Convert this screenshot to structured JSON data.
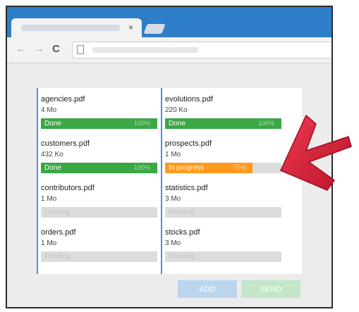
{
  "browser": {
    "tab_close": "×",
    "nav": {
      "back": "←",
      "forward": "→",
      "reload": "C"
    }
  },
  "colors": {
    "accent": "#4a90e2",
    "done": "#3aa845",
    "in_progress": "#ff9a1f",
    "pending": "#dcdcdc",
    "arrow": "#d7263d"
  },
  "files": [
    {
      "name": "agencies.pdf",
      "size": "4 Mo",
      "status": "Done",
      "progress": "100%",
      "state": "done",
      "fraction": 1.0
    },
    {
      "name": "customers.pdf",
      "size": "432 Ko",
      "status": "Done",
      "progress": "100%",
      "state": "done",
      "fraction": 1.0
    },
    {
      "name": "contributors.pdf",
      "size": "1 Mo",
      "status": "Pending",
      "progress": "",
      "state": "pending",
      "fraction": 0
    },
    {
      "name": "orders.pdf",
      "size": "1 Mo",
      "status": "Pending",
      "progress": "",
      "state": "pending",
      "fraction": 0
    },
    {
      "name": "evolutions.pdf",
      "size": "220 Ko",
      "status": "Done",
      "progress": "100%",
      "state": "done",
      "fraction": 1.0
    },
    {
      "name": "prospects.pdf",
      "size": "1 Mo",
      "status": "In progress",
      "progress": "75%",
      "state": "in_progress",
      "fraction": 0.75
    },
    {
      "name": "statistics.pdf",
      "size": "3 Mo",
      "status": "Pending",
      "progress": "",
      "state": "pending",
      "fraction": 0
    },
    {
      "name": "stocks.pdf",
      "size": "3 Mo",
      "status": "Pending",
      "progress": "",
      "state": "pending",
      "fraction": 0
    }
  ],
  "buttons": {
    "add": "ADD",
    "send": "SEND"
  }
}
